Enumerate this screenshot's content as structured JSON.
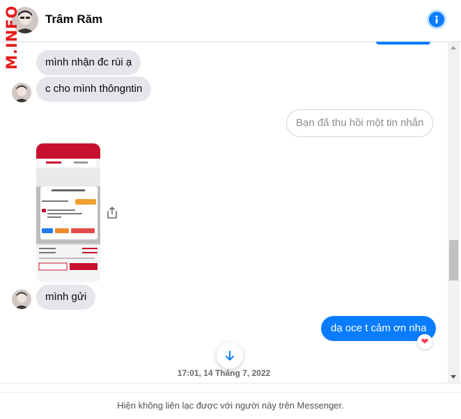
{
  "header": {
    "contact_name": "Trâm Răm",
    "info_icon": "info-icon"
  },
  "watermark": {
    "text": "M.INFO"
  },
  "messages": [
    {
      "direction": "incoming",
      "text": "mình nhận đc rùi ạ"
    },
    {
      "direction": "incoming",
      "text": "c cho mình thôngntin"
    },
    {
      "direction": "outgoing",
      "text": "Bạn đã thu hồi một tin nhắn",
      "unsent": true
    },
    {
      "direction": "incoming",
      "type": "image",
      "content": "screenshot of order confirmation"
    },
    {
      "direction": "incoming",
      "text": "mình gửi"
    },
    {
      "direction": "outgoing",
      "text": "dạ oce t cảm ơn nha",
      "reaction": "heart"
    }
  ],
  "timestamp": "17:01, 14 Tháng 7, 2022",
  "footer": {
    "notice": "Hiện không liên lạc được với người này trên Messenger."
  },
  "colors": {
    "accent": "#0a7cff",
    "incoming_bubble": "#e4e6eb",
    "watermark": "#e41a1a"
  }
}
